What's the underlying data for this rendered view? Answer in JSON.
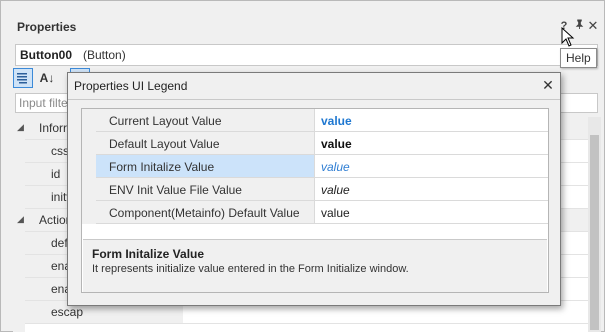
{
  "panel": {
    "title": "Properties",
    "header_buttons": {
      "help": "?",
      "pin": "📌",
      "close": "✕"
    },
    "object": {
      "name": "Button00",
      "type": "(Button)"
    },
    "filter": {
      "placeholder": "Input filte"
    },
    "tooltip": "Help",
    "toolbar": {
      "alpha_label": "A↓"
    }
  },
  "grid": {
    "rows": [
      {
        "label": "Inforr",
        "kind": "category"
      },
      {
        "label": "csscla",
        "kind": "property"
      },
      {
        "label": "id",
        "kind": "property"
      },
      {
        "label": "initva",
        "kind": "property"
      },
      {
        "label": "Action",
        "kind": "category"
      },
      {
        "label": "defau",
        "kind": "property"
      },
      {
        "label": "enabl",
        "kind": "property"
      },
      {
        "label": "enabl",
        "kind": "property"
      },
      {
        "label": "escap",
        "kind": "property"
      }
    ]
  },
  "dialog": {
    "title": "Properties UI Legend",
    "close": "✕",
    "rows": [
      {
        "name": "Current Layout Value",
        "value": "value",
        "style": "blue-bold"
      },
      {
        "name": "Default Layout Value",
        "value": "value",
        "style": "black-bold"
      },
      {
        "name": "Form Initalize Value",
        "value": "value",
        "style": "blue-italic",
        "selected": true
      },
      {
        "name": "ENV Init Value File Value",
        "value": "value",
        "style": "black-italic"
      },
      {
        "name": "Component(Metainfo) Default Value",
        "value": "value",
        "style": "plain"
      }
    ],
    "description": {
      "title": "Form Initalize Value",
      "text": "It represents initialize value entered in the Form Initialize window."
    }
  },
  "colors": {
    "accent": "#1f78d1",
    "selection": "#cce3fa",
    "panel_bg": "#f0f0f0"
  }
}
